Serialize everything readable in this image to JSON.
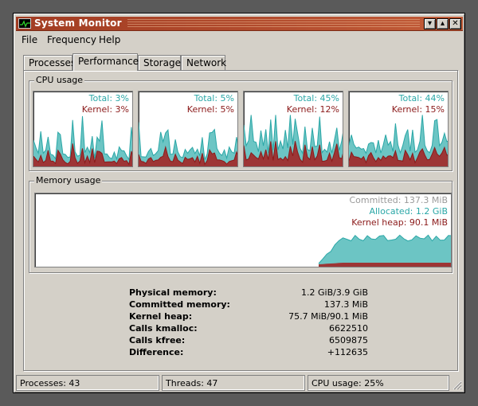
{
  "window": {
    "title": "System Monitor"
  },
  "titlebar_buttons": [
    "▾",
    "▴",
    "✕"
  ],
  "menu": [
    "File",
    "Frequency",
    "Help"
  ],
  "tabs": [
    "Processes",
    "Performance",
    "Storage",
    "Network"
  ],
  "active_tab": "Performance",
  "cpu": {
    "group_label": "CPU usage",
    "cores": [
      {
        "total": "Total:  3%",
        "kernel": "Kernel:  3%"
      },
      {
        "total": "Total:  5%",
        "kernel": "Kernel:  5%"
      },
      {
        "total": "Total: 45%",
        "kernel": "Kernel: 12%"
      },
      {
        "total": "Total: 44%",
        "kernel": "Kernel: 15%"
      }
    ]
  },
  "memory": {
    "group_label": "Memory usage",
    "committed": "Committed: 137.3 MiB",
    "allocated": "Allocated: 1.2 GiB",
    "kernel_heap": "Kernel heap: 90.1 MiB"
  },
  "stats": [
    {
      "key": "Physical memory:",
      "value": "1.2 GiB/3.9 GiB"
    },
    {
      "key": "Committed memory:",
      "value": "137.3 MiB"
    },
    {
      "key": "Kernel heap:",
      "value": "75.7 MiB/90.1 MiB"
    },
    {
      "key": "Calls kmalloc:",
      "value": "6622510"
    },
    {
      "key": "Calls kfree:",
      "value": "6509875"
    },
    {
      "key": "Difference:",
      "value": "+112635"
    }
  ],
  "status": {
    "processes": "Processes: 43",
    "threads": "Threads: 47",
    "cpu_usage": "CPU usage: 25%"
  },
  "colors": {
    "total": "#2aa7a7",
    "total_fill": "#6cc5c4",
    "kernel": "#8b1a1a",
    "kernel_fill": "#9d3535",
    "title": "#a23c22"
  }
}
